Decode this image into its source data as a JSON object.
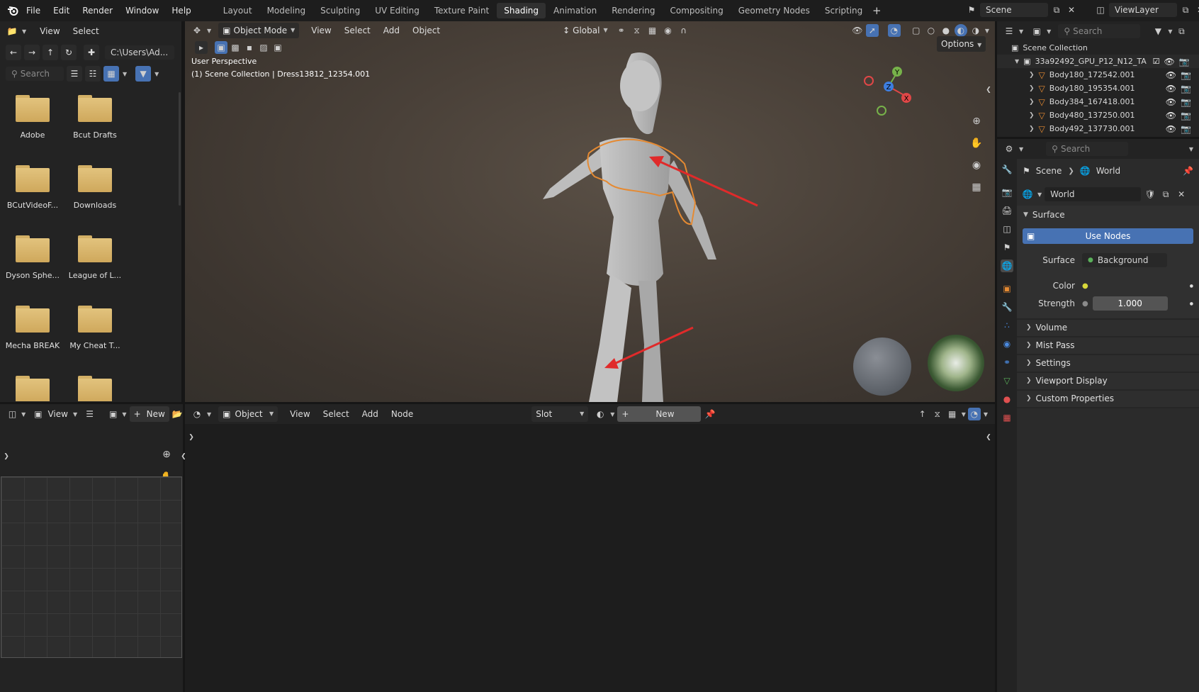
{
  "topbar": {
    "menus": [
      "File",
      "Edit",
      "Render",
      "Window",
      "Help"
    ],
    "workspaces": [
      "Layout",
      "Modeling",
      "Sculpting",
      "UV Editing",
      "Texture Paint",
      "Shading",
      "Animation",
      "Rendering",
      "Compositing",
      "Geometry Nodes",
      "Scripting"
    ],
    "active_workspace": "Shading",
    "scene": "Scene",
    "view_layer": "ViewLayer"
  },
  "filebrowser": {
    "menu_view": "View",
    "menu_select": "Select",
    "path": "C:\\Users\\Ad...",
    "search_placeholder": "Search",
    "folders": [
      "Adobe",
      "Bcut Drafts",
      "BCutVideoF...",
      "Downloads",
      "Dyson Sphe...",
      "League of L...",
      "Mecha BREAK",
      "My Cheat T...",
      "",
      ""
    ]
  },
  "viewport": {
    "mode": "Object Mode",
    "menus": [
      "View",
      "Select",
      "Add",
      "Object"
    ],
    "transform_orientation": "Global",
    "options_label": "Options",
    "perspective_label": "User Perspective",
    "collection_label": "(1) Scene Collection | Dress13812_12354.001",
    "gizmo_axes": {
      "x": "X",
      "y": "Y",
      "z": "Z"
    }
  },
  "nodeeditor": {
    "type": "Object",
    "menus": [
      "View",
      "Select",
      "Add",
      "Node"
    ],
    "slot": "Slot",
    "new_label": "New"
  },
  "imageeditor": {
    "view_label": "View",
    "new_label": "New"
  },
  "outliner": {
    "search_placeholder": "Search",
    "root": "Scene Collection",
    "collection": "33a92492_GPU_P12_N12_TA",
    "items": [
      "Body180_172542.001",
      "Body180_195354.001",
      "Body384_167418.001",
      "Body480_137250.001",
      "Body492_137730.001"
    ]
  },
  "properties": {
    "search_placeholder": "Search",
    "breadcrumb_scene": "Scene",
    "breadcrumb_world": "World",
    "world_name": "World",
    "surface_panel": "Surface",
    "use_nodes": "Use Nodes",
    "surface_label": "Surface",
    "surface_value": "Background",
    "color_label": "Color",
    "strength_label": "Strength",
    "strength_value": "1.000",
    "collapsed_panels": [
      "Volume",
      "Mist Pass",
      "Settings",
      "Viewport Display",
      "Custom Properties"
    ]
  },
  "colors": {
    "accent_blue": "#4772b3",
    "selection_orange": "#e58a32",
    "annotation_red": "#e02a2a",
    "folder_yellow": "#dcba72"
  }
}
